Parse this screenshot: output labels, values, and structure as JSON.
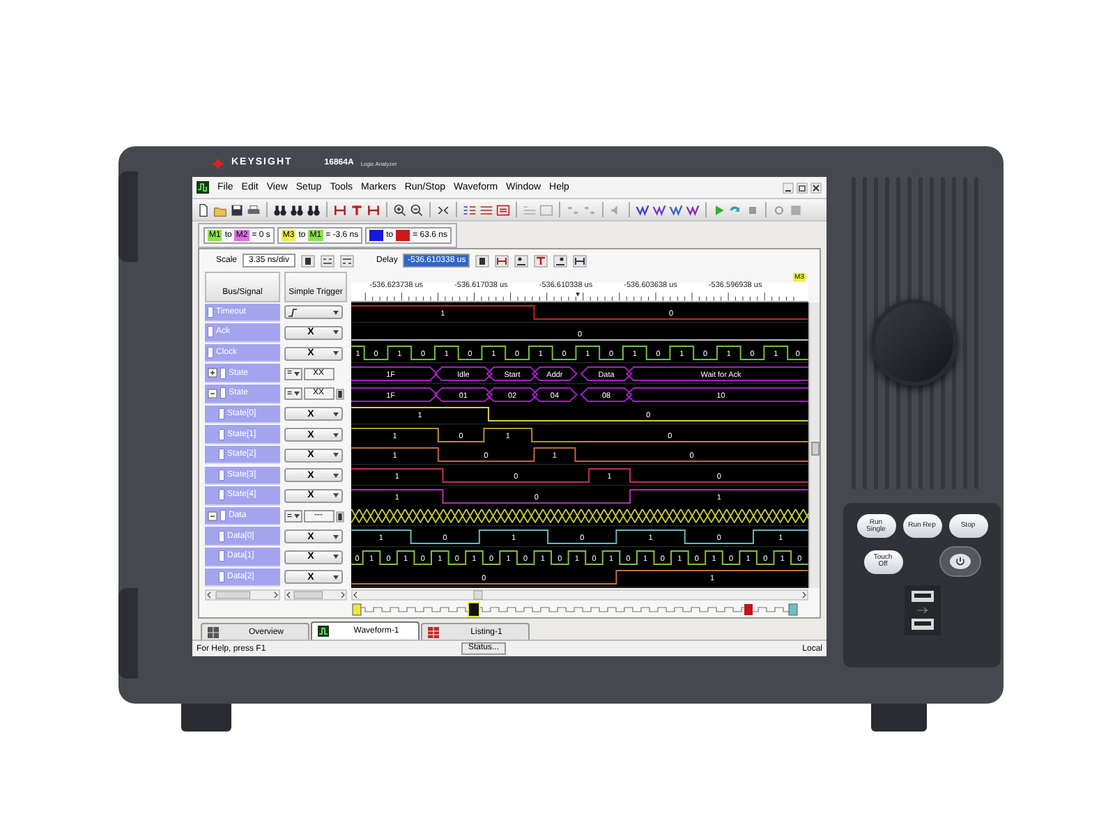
{
  "device": {
    "brand": "KEYSIGHT",
    "model": "16864A",
    "product": "Logic Analyzer"
  },
  "menu": [
    "File",
    "Edit",
    "View",
    "Setup",
    "Tools",
    "Markers",
    "Run/Stop",
    "Waveform",
    "Window",
    "Help"
  ],
  "marker_measurements": [
    {
      "from": {
        "label": "M1",
        "color": "#8ee04a"
      },
      "joiner": "to",
      "to": {
        "label": "M2",
        "color": "#e070e8"
      },
      "result": "= 0 s"
    },
    {
      "from": {
        "label": "M3",
        "color": "#eeee40"
      },
      "joiner": "to",
      "to": {
        "label": "M1",
        "color": "#8ee04a"
      },
      "result": "= -3.6 ns"
    },
    {
      "from": {
        "color": "#1818d8"
      },
      "joiner": "to",
      "to": {
        "color": "#d01818"
      },
      "result": "= 63.6 ns"
    }
  ],
  "scale": {
    "label": "Scale",
    "value": "3.35 ns/div"
  },
  "delay": {
    "label": "Delay",
    "value": "-536.610338 us"
  },
  "columns": [
    "Bus/Signal",
    "Simple Trigger"
  ],
  "marker_flag": "M3",
  "time_labels": [
    "-536.623738 us",
    "-536.617038 us",
    "-536.610338 us",
    "-536.603638 us",
    "-536.596938 us"
  ],
  "signals": [
    {
      "name": "Timeout",
      "kind": "bit",
      "color": "#d02020",
      "start_high": true,
      "trigger": {
        "kind": "edge"
      },
      "values": [
        "1",
        "0"
      ]
    },
    {
      "name": "Ack",
      "kind": "bit",
      "color": "#b0b0b0",
      "start_high": false,
      "trigger": {
        "kind": "bit",
        "value": "X"
      },
      "values": [
        "0"
      ]
    },
    {
      "name": "Clock",
      "kind": "bit",
      "color": "#70c040",
      "start_high": true,
      "trigger": {
        "kind": "bit",
        "value": "X"
      },
      "values": [
        "1",
        "0",
        "1",
        "0",
        "1",
        "0",
        "1",
        "0",
        "1",
        "0",
        "1",
        "0",
        "1",
        "0",
        "1",
        "0",
        "1",
        "0",
        "1",
        "0"
      ]
    },
    {
      "name": "State",
      "kind": "bus",
      "expanded": false,
      "color": "#a020c0",
      "trigger": {
        "kind": "bus",
        "operator": "=",
        "value": "XX"
      },
      "values": [
        "1F",
        "Idle",
        "Start",
        "Addr",
        "Data",
        "Wait for Ack"
      ]
    },
    {
      "name": "State",
      "kind": "bus",
      "expanded": true,
      "color": "#a020c0",
      "trigger": {
        "kind": "bus",
        "operator": "=",
        "value": "XX"
      },
      "values": [
        "1F",
        "01",
        "02",
        "04",
        "08",
        "10"
      ],
      "children": [
        {
          "name": "State[0]",
          "kind": "bit",
          "color": "#d8d040",
          "start_high": true,
          "trigger": {
            "kind": "bit",
            "value": "X"
          },
          "values": [
            "1",
            "0"
          ]
        },
        {
          "name": "State[1]",
          "kind": "bit",
          "color": "#b89030",
          "start_high": true,
          "trigger": {
            "kind": "bit",
            "value": "X"
          },
          "values": [
            "1",
            "0",
            "1",
            "0"
          ]
        },
        {
          "name": "State[2]",
          "kind": "bit",
          "color": "#c06838",
          "start_high": true,
          "trigger": {
            "kind": "bit",
            "value": "X"
          },
          "values": [
            "1",
            "0",
            "1",
            "0"
          ]
        },
        {
          "name": "State[3]",
          "kind": "bit",
          "color": "#c82860",
          "start_high": true,
          "trigger": {
            "kind": "bit",
            "value": "X"
          },
          "values": [
            "1",
            "0",
            "1",
            "0"
          ]
        },
        {
          "name": "State[4]",
          "kind": "bit",
          "color": "#b030a8",
          "start_high": true,
          "trigger": {
            "kind": "bit",
            "value": "X"
          },
          "values": [
            "1",
            "0",
            "1"
          ]
        }
      ]
    },
    {
      "name": "Data",
      "kind": "bus",
      "expanded": true,
      "color": "#c8c838",
      "trigger": {
        "kind": "bus",
        "operator": "=",
        "value": "---"
      },
      "children": [
        {
          "name": "Data[0]",
          "kind": "bit",
          "color": "#60b8c0",
          "start_high": true,
          "trigger": {
            "kind": "bit",
            "value": "X"
          },
          "values": [
            "1",
            "0",
            "1",
            "0",
            "1",
            "0",
            "1"
          ]
        },
        {
          "name": "Data[1]",
          "kind": "bit",
          "color": "#80c040",
          "start_high": false,
          "trigger": {
            "kind": "bit",
            "value": "X"
          },
          "values": [
            "0",
            "1",
            "0",
            "1",
            "0",
            "1",
            "0",
            "1",
            "0",
            "1",
            "0",
            "1",
            "0",
            "1",
            "0",
            "1",
            "0",
            "1",
            "0",
            "1",
            "0",
            "1",
            "0",
            "1",
            "0",
            "1",
            "0"
          ]
        },
        {
          "name": "Data[2]",
          "kind": "bit",
          "color": "#c07030",
          "start_high": false,
          "trigger": {
            "kind": "bit",
            "value": "X"
          },
          "values": [
            "0",
            "1"
          ]
        }
      ]
    }
  ],
  "tabs": [
    {
      "label": "Overview",
      "selected": false
    },
    {
      "label": "Waveform-1",
      "selected": true
    },
    {
      "label": "Listing-1",
      "selected": false
    }
  ],
  "status_bar": {
    "help": "For Help, press F1",
    "button": "Status...",
    "mode": "Local"
  },
  "front_panel": {
    "buttons": [
      "Run Single",
      "Run Rep",
      "Stop"
    ],
    "touch_button": "Touch Off"
  }
}
